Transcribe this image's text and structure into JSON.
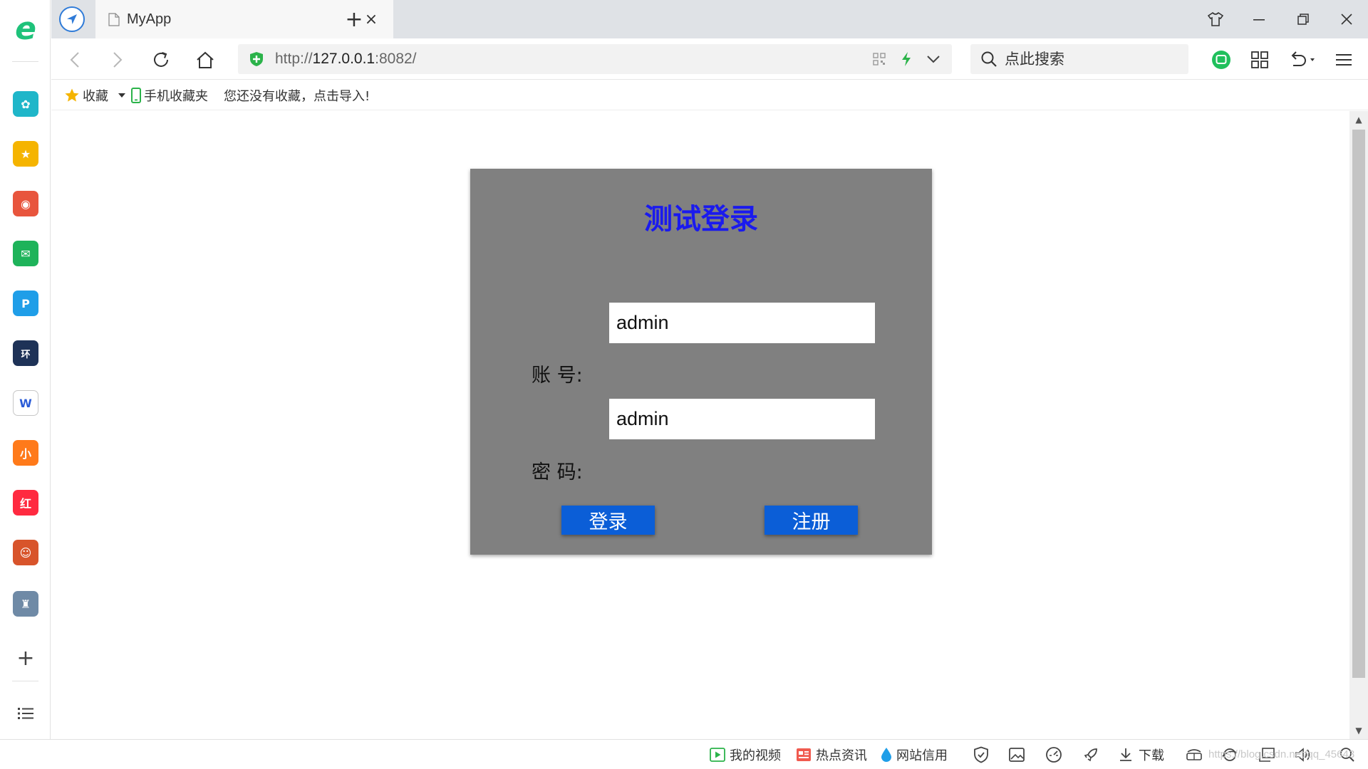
{
  "browser": {
    "tab_title": "MyApp",
    "tab_close_glyph": "×",
    "new_tab_glyph": "+",
    "address_scheme": "http://",
    "address_host": "127.0.0.1",
    "address_port_path": ":8082/",
    "search_placeholder": "点此搜索",
    "accent_color": "#2f7bd8"
  },
  "bookmarks": {
    "favorites_label": "收藏",
    "mobile_label": "手机收藏夹",
    "hint": "您还没有收藏，点击导入!"
  },
  "sidebar": {
    "logo_letter": "e",
    "plus_glyph": "+",
    "apps": [
      {
        "icon": "cloud-icon",
        "color": "#1fb6c9",
        "glyph": "✿"
      },
      {
        "icon": "star-icon",
        "color": "#f5b400",
        "glyph": "★"
      },
      {
        "icon": "weibo-icon",
        "color": "#e8553d",
        "glyph": "◉"
      },
      {
        "icon": "mail-icon",
        "color": "#1eb35a",
        "glyph": "✉"
      },
      {
        "icon": "pptv-icon",
        "color": "#1f9ee8",
        "glyph": "P"
      },
      {
        "icon": "school-icon",
        "color": "#1e3257",
        "glyph": "环"
      },
      {
        "icon": "word-doc-icon",
        "color": "#ffffff",
        "glyph": "W"
      },
      {
        "icon": "novel-icon",
        "color": "#ff7a1a",
        "glyph": "小"
      },
      {
        "icon": "xiaohongshu-icon",
        "color": "#ff2a40",
        "glyph": "红"
      },
      {
        "icon": "game-king-icon",
        "color": "#d8542b",
        "glyph": "☺"
      },
      {
        "icon": "game-tank-icon",
        "color": "#6f8aa6",
        "glyph": "♜"
      }
    ]
  },
  "login": {
    "title": "测试登录",
    "account_label": "账 号:",
    "account_value": "admin",
    "password_label": "密 码:",
    "password_value": "admin",
    "login_button": "登录",
    "register_button": "注册",
    "title_color": "#1a1aee",
    "button_color": "#0b5ed7",
    "panel_color": "#808080"
  },
  "statusbar": {
    "my_video": "我的视频",
    "hot_news": "热点资讯",
    "site_credit": "网站信用",
    "download": "下载",
    "watermark": "https://blog.csdn.net/qq_45643"
  }
}
